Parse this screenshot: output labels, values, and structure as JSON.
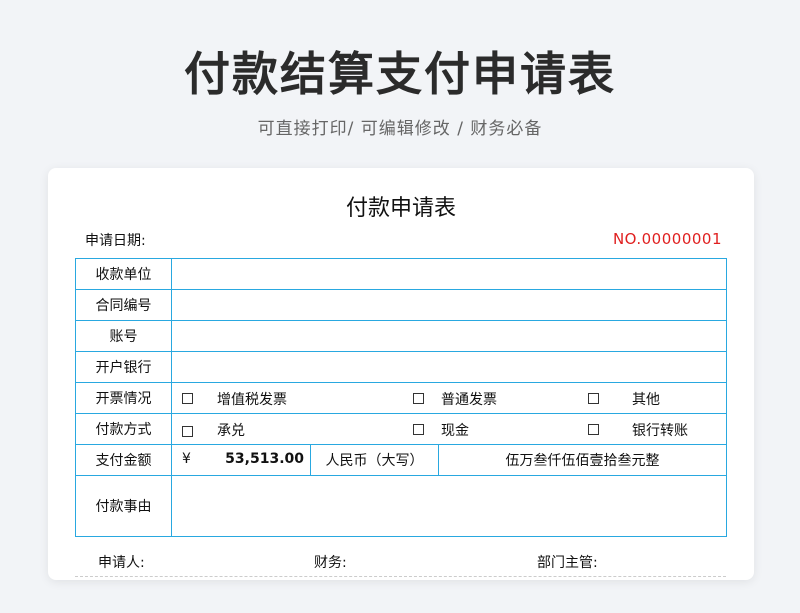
{
  "page": {
    "title": "付款结算支付申请表",
    "subtitle": "可直接打印/ 可编辑修改 / 财务必备"
  },
  "form": {
    "title": "付款申请表",
    "date_label": "申请日期:",
    "doc_no": "NO.00000001",
    "rows": {
      "payee": "收款单位",
      "contract_no": "合同编号",
      "account_no": "账号",
      "bank": "开户银行",
      "invoice": "开票情况",
      "method": "付款方式",
      "amount": "支付金额",
      "reason": "付款事由"
    },
    "invoice_options": [
      "增值税发票",
      "普通发票",
      "其他"
    ],
    "method_options": [
      "承兑",
      "现金",
      "银行转账"
    ],
    "amount": {
      "currency_symbol": "¥",
      "value": "53,513.00",
      "uppercase_label": "人民币（大写）",
      "uppercase_value": "伍万叁仟伍佰壹拾叁元整"
    },
    "footer": {
      "applicant": "申请人:",
      "finance": "财务:",
      "manager": "部门主管:"
    }
  }
}
